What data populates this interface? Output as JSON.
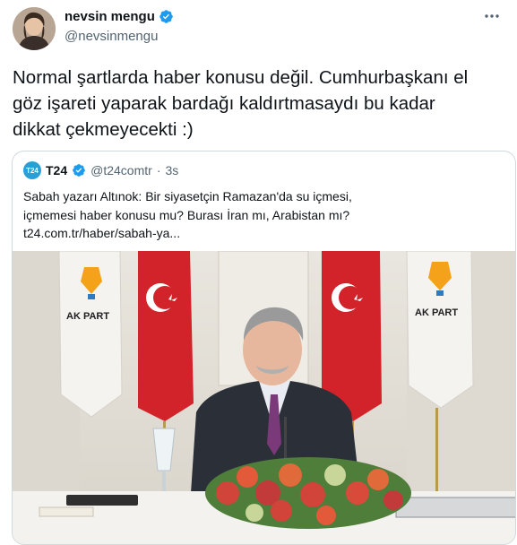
{
  "user": {
    "name": "nevsin mengu",
    "handle": "@nevsinmengu",
    "verified": true,
    "avatar_icon": "profile-photo"
  },
  "menu_icon": "more-options-icon",
  "tweet": {
    "text": "Normal şartlarda haber konusu değil. Cumhurbaşkanı el\ngöz işareti yaparak bardağı kaldırtmasaydı bu kadar\ndikkat çekmeyecekti :)"
  },
  "quote": {
    "logo_text": "T24",
    "name": "T24",
    "handle": "@t24comtr",
    "separator": "·",
    "time": "3s",
    "text": "Sabah yazarı Altınok: Bir siyasetçin Ramazan'da su içmesi,\niçmemesi haber konusu mu? Burası İran mı, Arabistan mı?\nt24.com.tr/haber/sabah-ya...",
    "image_label_left": "AK PART",
    "image_label_right": "AK PART"
  },
  "colors": {
    "verified_blue": "#1d9bf0",
    "secondary_text": "#536471",
    "border": "#cfd9de",
    "flag_red": "#d2232a"
  }
}
